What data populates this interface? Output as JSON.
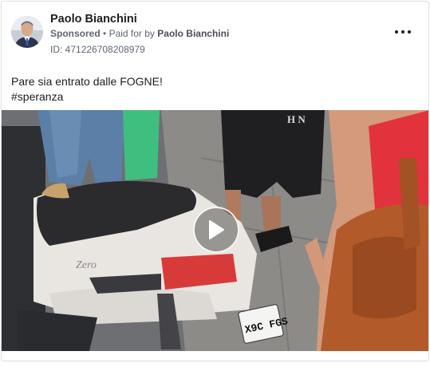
{
  "post": {
    "author": "Paolo Bianchini",
    "sponsored": "Sponsored",
    "separator": "•",
    "paid_for_by_prefix": "Paid for by",
    "payer": "Paolo Bianchini",
    "ad_id": "ID: 471226708208979",
    "caption_line1": "Pare sia entrato dalle FOGNE!",
    "caption_line2": "#speranza"
  },
  "media": {
    "type": "video",
    "scene_text_shirt": "H N",
    "scene_text_scooter": "Zero",
    "scene_text_plate": "X9C FGS"
  },
  "icons": {
    "more": "more-options-icon",
    "play": "play-icon",
    "avatar": "avatar"
  },
  "colors": {
    "text_primary": "#1c1e21",
    "text_secondary": "#606770",
    "border": "#dddfe2"
  }
}
